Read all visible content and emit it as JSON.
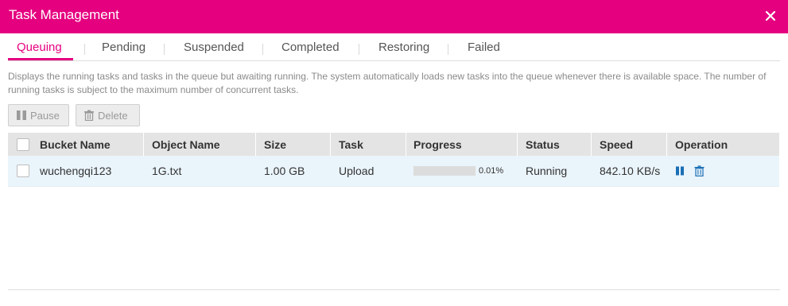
{
  "dialog": {
    "title": "Task Management"
  },
  "tabs": [
    {
      "label": "Queuing",
      "active": true
    },
    {
      "label": "Pending",
      "active": false
    },
    {
      "label": "Suspended",
      "active": false
    },
    {
      "label": "Completed",
      "active": false
    },
    {
      "label": "Restoring",
      "active": false
    },
    {
      "label": "Failed",
      "active": false
    }
  ],
  "description": "Displays the running tasks and tasks in the queue but awaiting running. The system automatically loads new tasks into the queue whenever there is available space. The number of running tasks is subject to the maximum number of concurrent tasks.",
  "toolbar": {
    "pause_label": "Pause",
    "delete_label": "Delete"
  },
  "table": {
    "columns": [
      "Bucket Name",
      "Object Name",
      "Size",
      "Task",
      "Progress",
      "Status",
      "Speed",
      "Operation"
    ],
    "rows": [
      {
        "bucket": "wuchengqi123",
        "object": "1G.txt",
        "size": "1.00 GB",
        "task": "Upload",
        "progress_fraction": 0.0001,
        "progress_text": "0.01%",
        "status": "Running",
        "speed": "842.10 KB/s"
      }
    ]
  },
  "colors": {
    "accent": "#e5007f",
    "operation_icon": "#1a6fb5"
  },
  "icons": {
    "close": "close-icon",
    "pause": "pause-icon",
    "delete": "trash-icon"
  }
}
